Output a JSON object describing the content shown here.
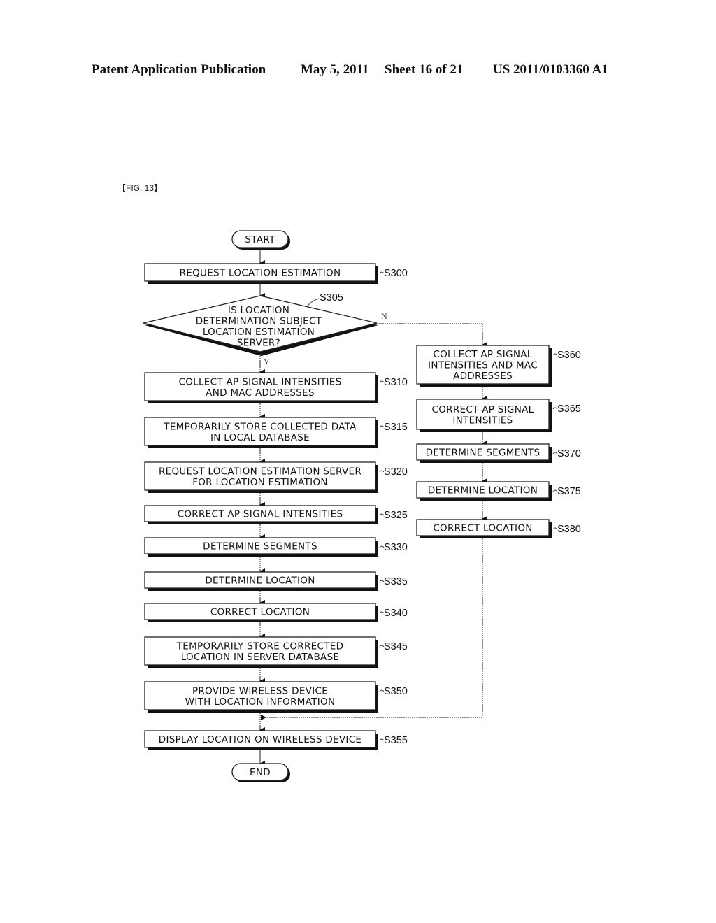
{
  "header": {
    "publication": "Patent Application Publication",
    "date": "May 5, 2011",
    "sheet": "Sheet 16 of 21",
    "number": "US 2011/0103360 A1"
  },
  "figure_label": "【FIG. 13】",
  "flowchart": {
    "start": "START",
    "end": "END",
    "decision": {
      "id": "S305",
      "lines": [
        "IS LOCATION",
        "DETERMINATION SUBJECT",
        "LOCATION ESTIMATION",
        "SERVER?"
      ],
      "yes_label": "Y",
      "no_label": "N"
    },
    "left_steps": [
      {
        "id": "S300",
        "lines": [
          "REQUEST LOCATION ESTIMATION"
        ]
      },
      {
        "id": "S310",
        "lines": [
          "COLLECT AP SIGNAL INTENSITIES",
          "AND MAC ADDRESSES"
        ]
      },
      {
        "id": "S315",
        "lines": [
          "TEMPORARILY STORE COLLECTED DATA",
          "IN LOCAL DATABASE"
        ]
      },
      {
        "id": "S320",
        "lines": [
          "REQUEST LOCATION ESTIMATION SERVER",
          "FOR LOCATION ESTIMATION"
        ]
      },
      {
        "id": "S325",
        "lines": [
          "CORRECT AP SIGNAL INTENSITIES"
        ]
      },
      {
        "id": "S330",
        "lines": [
          "DETERMINE SEGMENTS"
        ]
      },
      {
        "id": "S335",
        "lines": [
          "DETERMINE LOCATION"
        ]
      },
      {
        "id": "S340",
        "lines": [
          "CORRECT LOCATION"
        ]
      },
      {
        "id": "S345",
        "lines": [
          "TEMPORARILY STORE CORRECTED",
          "LOCATION IN SERVER DATABASE"
        ]
      },
      {
        "id": "S350",
        "lines": [
          "PROVIDE WIRELESS DEVICE",
          "WITH LOCATION INFORMATION"
        ]
      },
      {
        "id": "S355",
        "lines": [
          "DISPLAY LOCATION ON WIRELESS DEVICE"
        ]
      }
    ],
    "right_steps": [
      {
        "id": "S360",
        "lines": [
          "COLLECT AP SIGNAL",
          "INTENSITIES AND MAC",
          "ADDRESSES"
        ]
      },
      {
        "id": "S365",
        "lines": [
          "CORRECT AP SIGNAL",
          "INTENSITIES"
        ]
      },
      {
        "id": "S370",
        "lines": [
          "DETERMINE SEGMENTS"
        ]
      },
      {
        "id": "S375",
        "lines": [
          "DETERMINE LOCATION"
        ]
      },
      {
        "id": "S380",
        "lines": [
          "CORRECT LOCATION"
        ]
      }
    ]
  }
}
